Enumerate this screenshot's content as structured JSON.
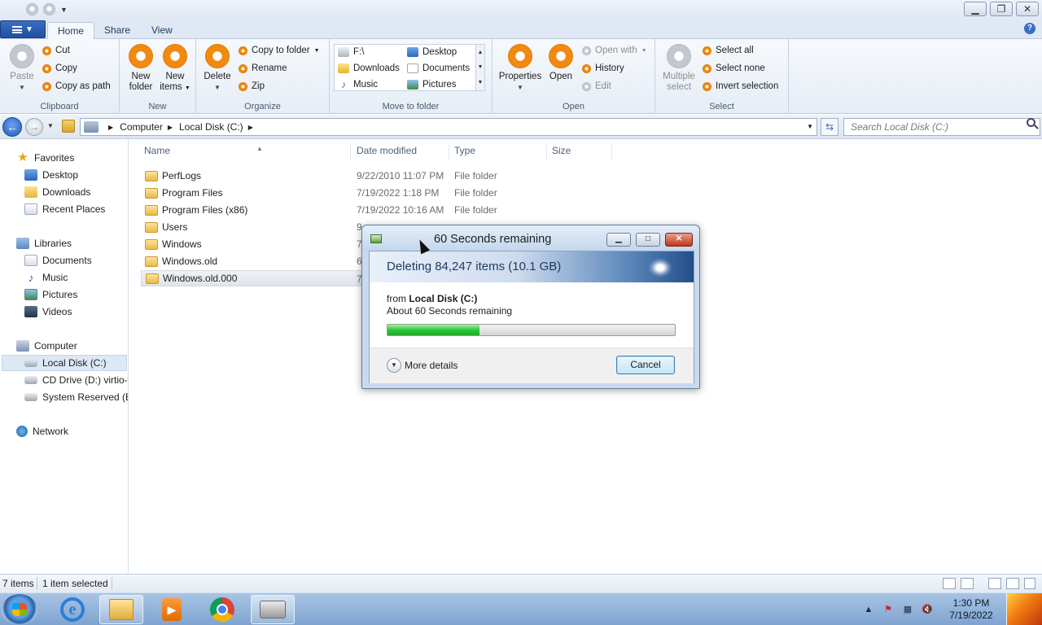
{
  "ribbon_tabs": [
    "Home",
    "Share",
    "View"
  ],
  "clipboard": {
    "paste": "Paste",
    "cut": "Cut",
    "copy": "Copy",
    "copy_as_path": "Copy as path",
    "label": "Clipboard"
  },
  "new_group": {
    "new_folder_l1": "New",
    "new_folder_l2": "folder",
    "new_items_l1": "New",
    "new_items_l2": "items",
    "label": "New"
  },
  "organize": {
    "delete": "Delete",
    "copy_to_folder": "Copy to folder",
    "rename": "Rename",
    "zip": "Zip",
    "label": "Organize"
  },
  "move_to": {
    "items": [
      "F:\\",
      "Desktop",
      "Downloads",
      "Documents",
      "Music",
      "Pictures"
    ],
    "label": "Move to folder"
  },
  "open_group": {
    "properties": "Properties",
    "open": "Open",
    "open_with": "Open with",
    "history": "History",
    "edit": "Edit",
    "label": "Open"
  },
  "select_group": {
    "multiple_l1": "Multiple",
    "multiple_l2": "select",
    "select_all": "Select all",
    "select_none": "Select none",
    "invert_selection": "Invert selection",
    "label": "Select"
  },
  "address": {
    "crumbs": [
      "Computer",
      "Local Disk (C:)"
    ],
    "search_placeholder": "Search Local Disk (C:)"
  },
  "nav": {
    "favorites": "Favorites",
    "favorites_items": [
      "Desktop",
      "Downloads",
      "Recent Places"
    ],
    "libraries": "Libraries",
    "libraries_items": [
      "Documents",
      "Music",
      "Pictures",
      "Videos"
    ],
    "computer": "Computer",
    "computer_items": [
      "Local Disk (C:)",
      "CD Drive (D:) virtio-w",
      "System Reserved (E:)"
    ],
    "network": "Network"
  },
  "columns": [
    "Name",
    "Date modified",
    "Type",
    "Size"
  ],
  "files": [
    {
      "name": "PerfLogs",
      "date": "9/22/2010 11:07 PM",
      "type": "File folder"
    },
    {
      "name": "Program Files",
      "date": "7/19/2022 1:18 PM",
      "type": "File folder"
    },
    {
      "name": "Program Files (x86)",
      "date": "7/19/2022 10:16 AM",
      "type": "File folder"
    },
    {
      "name": "Users",
      "date": "9",
      "type": ""
    },
    {
      "name": "Windows",
      "date": "7",
      "type": ""
    },
    {
      "name": "Windows.old",
      "date": "6",
      "type": ""
    },
    {
      "name": "Windows.old.000",
      "date": "7",
      "type": ""
    }
  ],
  "status": {
    "count": "7 items",
    "selected": "1 item selected"
  },
  "dialog": {
    "title": "60 Seconds remaining",
    "heading": "Deleting 84,247 items (10.1 GB)",
    "from_prefix": "from",
    "from_location": "Local Disk (C:)",
    "remaining": "About 60 Seconds remaining",
    "progress_fraction": 0.32,
    "more_details": "More details",
    "cancel": "Cancel"
  },
  "clock": {
    "time": "1:30 PM",
    "date": "7/19/2022"
  },
  "colors": {
    "accent": "#1f4f9f",
    "ribbon_icon": "#f28a12",
    "progress": "#2ec43a"
  }
}
